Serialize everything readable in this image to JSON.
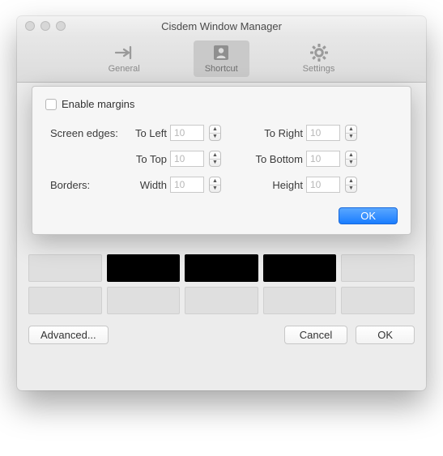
{
  "window": {
    "title": "Cisdem Window Manager"
  },
  "toolbar": {
    "general": "General",
    "shortcut": "Shortcut",
    "settings": "Settings"
  },
  "dialog": {
    "enable_margins": "Enable margins",
    "screen_edges_label": "Screen edges:",
    "to_left": "To Left",
    "to_right": "To Right",
    "to_top": "To Top",
    "to_bottom": "To Bottom",
    "borders_label": "Borders:",
    "width": "Width",
    "height": "Height",
    "values": {
      "left": "10",
      "right": "10",
      "top": "10",
      "bottom": "10",
      "bwidth": "10",
      "bheight": "10"
    },
    "ok": "OK"
  },
  "buttons": {
    "advanced": "Advanced...",
    "cancel": "Cancel",
    "ok": "OK"
  }
}
